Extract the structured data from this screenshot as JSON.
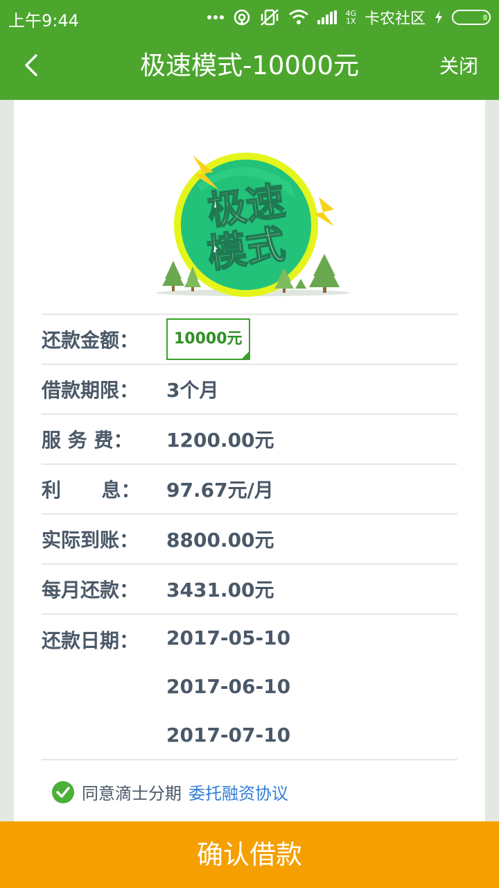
{
  "status_bar": {
    "time": "上午9:44",
    "carrier": "卡农社区",
    "network_top": "4G",
    "network_bottom": "1X"
  },
  "nav": {
    "title": "极速模式-10000元",
    "close_label": "关闭"
  },
  "logo": {
    "line1": "极速",
    "line2": "模式",
    "colors": {
      "ring": "#e4f51c",
      "badge": "#22c27a",
      "bolt": "#f7d21c",
      "tree": "#6aa84f"
    }
  },
  "details": {
    "repay_amount": {
      "label": "还款金额：",
      "value": "10000元"
    },
    "loan_term": {
      "label": "借款期限：",
      "value": "3个月"
    },
    "service_fee": {
      "label": "服 务 费：",
      "value": "1200.00元"
    },
    "interest": {
      "label": "利      息：",
      "value": "97.67元/月"
    },
    "actual_received": {
      "label": "实际到账：",
      "value": "8800.00元"
    },
    "monthly_repay": {
      "label": "每月还款：",
      "value": "3431.00元"
    },
    "repay_dates": {
      "label": "还款日期：",
      "values": [
        "2017-05-10",
        "2017-06-10",
        "2017-07-10"
      ]
    }
  },
  "agreement": {
    "text": "同意滴士分期",
    "link": "委托融资协议",
    "checked": true
  },
  "confirm_label": "确认借款",
  "colors": {
    "primary": "#4ca62e",
    "accent": "#f5a000",
    "link": "#2f7dd6",
    "text": "#4a5868"
  }
}
